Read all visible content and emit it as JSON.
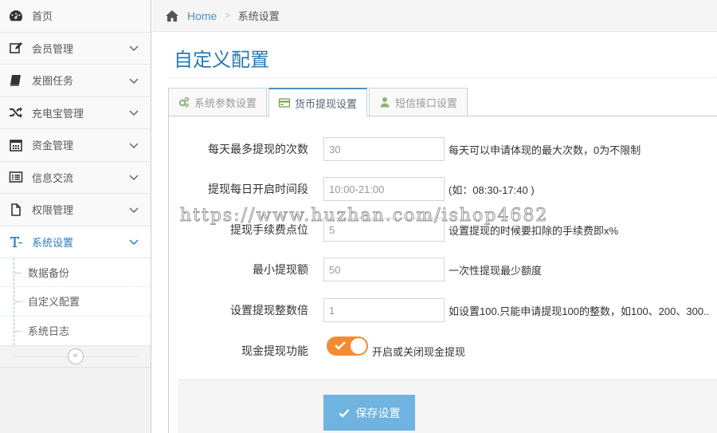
{
  "sidebar": {
    "items": [
      {
        "label": "首页",
        "icon": "dashboard-icon",
        "has_arrow": false
      },
      {
        "label": "会员管理",
        "icon": "edit-icon",
        "has_arrow": true
      },
      {
        "label": "发圈任务",
        "icon": "book-icon",
        "has_arrow": true
      },
      {
        "label": "充电宝管理",
        "icon": "random-icon",
        "has_arrow": true
      },
      {
        "label": "资金管理",
        "icon": "calendar-icon",
        "has_arrow": true
      },
      {
        "label": "信息交流",
        "icon": "list-alt-icon",
        "has_arrow": true
      },
      {
        "label": "权限管理",
        "icon": "file-icon",
        "has_arrow": true
      },
      {
        "label": "系统设置",
        "icon": "text-height-icon",
        "has_arrow": true,
        "active": true
      }
    ],
    "subitems": [
      {
        "label": "数据备份"
      },
      {
        "label": "自定义配置"
      },
      {
        "label": "系统日志"
      }
    ],
    "collapse_glyph": "«"
  },
  "breadcrumbs": {
    "home": "Home",
    "current": "系统设置"
  },
  "page": {
    "title": "自定义配置"
  },
  "tabs": [
    {
      "label": "系统参数设置",
      "icon": "cogs-icon"
    },
    {
      "label": "货币提现设置",
      "icon": "credit-card-icon",
      "active": true
    },
    {
      "label": "短信接口设置",
      "icon": "user-icon"
    }
  ],
  "form": {
    "fields": [
      {
        "label": "每天最多提现的次数",
        "value": "30",
        "help": "每天可以申请体现的最大次数，0为不限制"
      },
      {
        "label": "提现每日开启时间段",
        "value": "10:00-21:00",
        "help": "(如：08:30-17:40 )"
      },
      {
        "label": "提现手续费点位",
        "value": "5",
        "help": "设置提现的时候要扣除的手续费即x%"
      },
      {
        "label": "最小提现额",
        "value": "50",
        "help": "一次性提现最少额度"
      },
      {
        "label": "设置提现整数倍",
        "value": "1",
        "help": "如设置100.只能申请提现100的整数，如100、200、300.."
      }
    ],
    "switch": {
      "label": "现金提现功能",
      "help": "开启或关闭现金提现",
      "on": true
    },
    "save_label": "保存设置"
  },
  "watermark": "https://www.huzhan.com/ishop4682",
  "colors": {
    "accent": "#2679b5",
    "link": "#4c8fbd",
    "toggle_on": "#f58a30",
    "save_button": "#6fb3e0"
  }
}
